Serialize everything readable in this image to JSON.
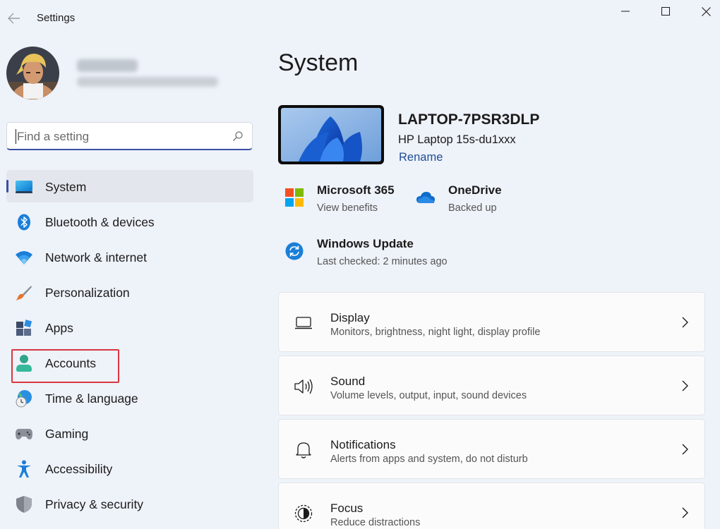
{
  "window": {
    "title": "Settings"
  },
  "search": {
    "placeholder": "Find a setting"
  },
  "sidebar": {
    "items": [
      {
        "label": "System",
        "icon": "system-icon",
        "selected": true
      },
      {
        "label": "Bluetooth & devices",
        "icon": "bluetooth-icon"
      },
      {
        "label": "Network & internet",
        "icon": "wifi-icon"
      },
      {
        "label": "Personalization",
        "icon": "brush-icon"
      },
      {
        "label": "Apps",
        "icon": "apps-icon"
      },
      {
        "label": "Accounts",
        "icon": "account-icon",
        "highlighted": true
      },
      {
        "label": "Time & language",
        "icon": "clock-globe-icon"
      },
      {
        "label": "Gaming",
        "icon": "gamepad-icon"
      },
      {
        "label": "Accessibility",
        "icon": "accessibility-icon"
      },
      {
        "label": "Privacy & security",
        "icon": "shield-icon"
      }
    ]
  },
  "main": {
    "title": "System",
    "device": {
      "name": "LAPTOP-7PSR3DLP",
      "model": "HP Laptop 15s-du1xxx",
      "rename_label": "Rename"
    },
    "quick": [
      {
        "title": "Microsoft 365",
        "subtitle": "View benefits",
        "icon": "microsoft-logo-icon"
      },
      {
        "title": "OneDrive",
        "subtitle": "Backed up",
        "icon": "onedrive-cloud-icon"
      },
      {
        "title": "Windows Update",
        "subtitle": "Last checked: 2 minutes ago",
        "icon": "windows-update-icon"
      }
    ],
    "cards": [
      {
        "title": "Display",
        "subtitle": "Monitors, brightness, night light, display profile",
        "icon": "laptop-icon"
      },
      {
        "title": "Sound",
        "subtitle": "Volume levels, output, input, sound devices",
        "icon": "speaker-icon"
      },
      {
        "title": "Notifications",
        "subtitle": "Alerts from apps and system, do not disturb",
        "icon": "bell-icon"
      },
      {
        "title": "Focus",
        "subtitle": "Reduce distractions",
        "icon": "focus-icon"
      }
    ]
  },
  "colors": {
    "background": "#eef2f9",
    "accent": "#3a4fa6",
    "link": "#1f4e98",
    "highlight_box": "#d9363e"
  }
}
